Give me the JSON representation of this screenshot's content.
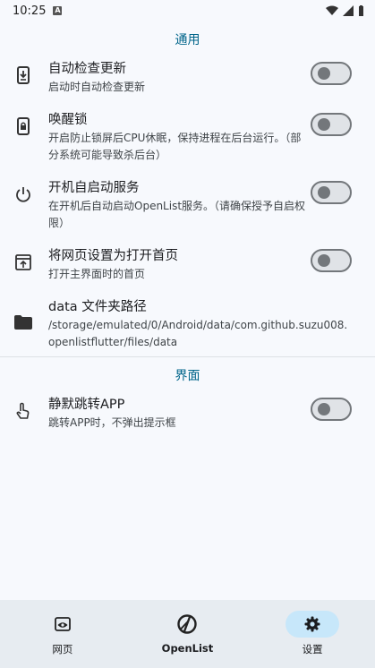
{
  "status_bar": {
    "time": "10:25",
    "notification_glyph": "A"
  },
  "sections": {
    "general": {
      "title": "通用",
      "items": [
        {
          "title": "自动检查更新",
          "subtitle": "启动时自动检查更新",
          "icon": "download-phone-icon",
          "toggle": false
        },
        {
          "title": "唤醒锁",
          "subtitle": "开启防止锁屏后CPU休眠，保持进程在后台运行。（部分系统可能导致杀后台）",
          "icon": "lock-phone-icon",
          "toggle": false
        },
        {
          "title": "开机自启动服务",
          "subtitle": "在开机后自动启动OpenList服务。（请确保授予自启权限）",
          "icon": "power-icon",
          "toggle": false
        },
        {
          "title": "将网页设置为打开首页",
          "subtitle": "打开主界面时的首页",
          "icon": "open-upload-icon",
          "toggle": false
        },
        {
          "title": "data 文件夹路径",
          "subtitle": "/storage/emulated/0/Android/data/com.github.suzu008.openlistflutter/files/data",
          "icon": "folder-icon"
        }
      ]
    },
    "interface": {
      "title": "界面",
      "items": [
        {
          "title": "静默跳转APP",
          "subtitle": "跳转APP时，不弹出提示框",
          "icon": "tap-icon",
          "toggle": false
        }
      ]
    }
  },
  "navbar": {
    "items": [
      {
        "label": "网页",
        "icon": "web-eye-icon",
        "active": false
      },
      {
        "label": "OpenList",
        "icon": "openlist-logo-icon",
        "active": false
      },
      {
        "label": "设置",
        "icon": "gear-icon",
        "active": true
      }
    ]
  },
  "colors": {
    "accent": "#00658a",
    "nav_active": "#c7e7fa",
    "background": "#f7f9fd"
  }
}
